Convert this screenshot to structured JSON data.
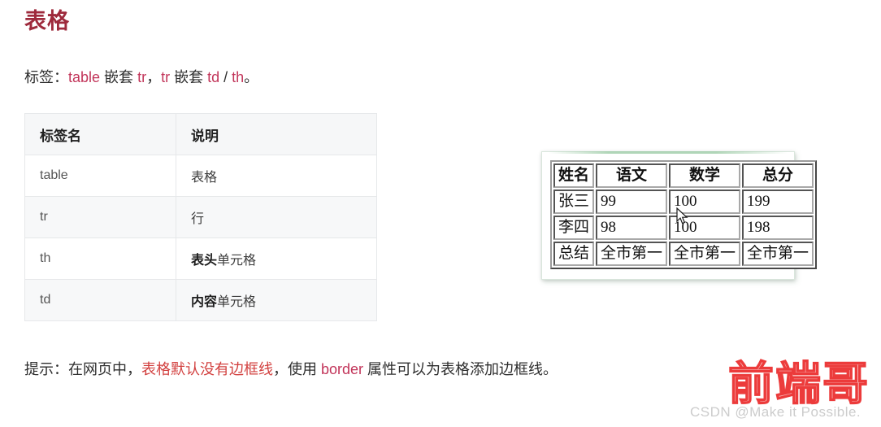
{
  "page": {
    "title": "表格",
    "title_color": "#9e2a3c",
    "background": "#ffffff"
  },
  "tag_line": {
    "prefix": "标签：",
    "code1": "table",
    "mid1": " 嵌套 ",
    "code2": "tr",
    "comma": "，",
    "code3": "tr",
    "mid2": " 嵌套 ",
    "code4": "td",
    "slash": " / ",
    "code5": "th",
    "period": "。",
    "code_color": "#c2355a"
  },
  "tag_table": {
    "headers": [
      "标签名",
      "说明"
    ],
    "rows": [
      {
        "tag": "table",
        "desc_bold": "",
        "desc_rest": "表格"
      },
      {
        "tag": "tr",
        "desc_bold": "",
        "desc_rest": "行"
      },
      {
        "tag": "th",
        "desc_bold": "表头",
        "desc_rest": "单元格"
      },
      {
        "tag": "td",
        "desc_bold": "内容",
        "desc_rest": "单元格"
      }
    ],
    "header_bg": "#f6f7f8",
    "stripe_bg": "#f7f8f9",
    "border_color": "#e6e8ea"
  },
  "figure": {
    "caption_alt": "带边框的成绩表格示例",
    "frame_border": "#d9e6dc",
    "score_table": {
      "headers": [
        "姓名",
        "语文",
        "数学",
        "总分"
      ],
      "rows": [
        [
          "张三",
          "99",
          "100",
          "199"
        ],
        [
          "李四",
          "98",
          "100",
          "198"
        ],
        [
          "总结",
          "全市第一",
          "全市第一",
          "全市第一"
        ]
      ]
    },
    "cursor": "arrow-cursor"
  },
  "tip_line": {
    "prefix": "提示：在网页中，",
    "highlight": "表格默认没有边框线",
    "mid": "，使用 ",
    "code": "border",
    "suffix": " 属性可以为表格添加边框线。",
    "highlight_color": "#d2403f",
    "code_color": "#c2355a"
  },
  "watermark": {
    "brand": "前端哥",
    "brand_color": "#ec3b3b",
    "csdn": "CSDN @Make it Possible.",
    "csdn_color": "#cccccc"
  }
}
